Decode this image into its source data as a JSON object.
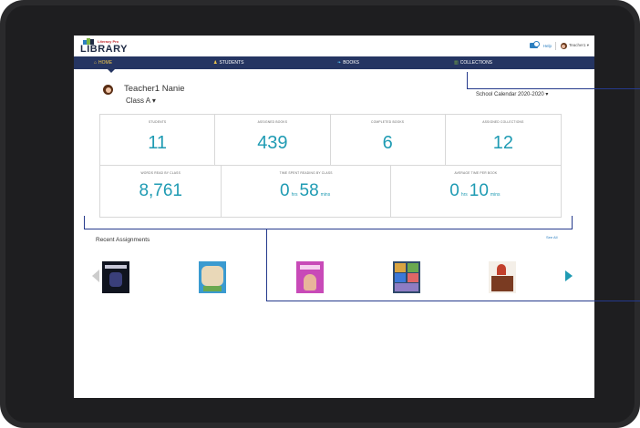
{
  "header": {
    "logo_small": "Literacy Pro",
    "logo_text": "LIBRARY",
    "help_label": "Help",
    "user_label": "Teacher1 ▾"
  },
  "nav": {
    "items": [
      {
        "label": "HOME",
        "icon": "home-icon"
      },
      {
        "label": "STUDENTS",
        "icon": "student-icon"
      },
      {
        "label": "BOOKS",
        "icon": "book-icon"
      },
      {
        "label": "COLLECTIONS",
        "icon": "collections-icon"
      }
    ]
  },
  "teacher": {
    "name": "Teacher1 Nanie",
    "class_label": "Class A ▾"
  },
  "calendar": {
    "label": "School Calendar 2020-2020 ▾"
  },
  "stats": {
    "students": {
      "label": "STUDENTS",
      "value": "11"
    },
    "assigned_books": {
      "label": "ASSIGNED BOOKS",
      "value": "439"
    },
    "completed_books": {
      "label": "COMPLETED BOOKS",
      "value": "6"
    },
    "assigned_collections": {
      "label": "ASSIGNED COLLECTIONS",
      "value": "12"
    },
    "words_read": {
      "label": "WORDS READ BY CLASS",
      "value": "8,761"
    },
    "time_spent": {
      "label": "TIME SPENT READING BY CLASS",
      "hours": "0",
      "hours_unit": "hrs",
      "minutes": "58",
      "minutes_unit": "mins"
    },
    "avg_time": {
      "label": "AVERAGE TIME PER BOOK",
      "hours": "0",
      "hours_unit": "hrs",
      "minutes": "10",
      "minutes_unit": "mins"
    }
  },
  "recent": {
    "title": "Recent Assignments",
    "see_all": "See All",
    "books": [
      {
        "name": "book-cover-1"
      },
      {
        "name": "book-cover-2"
      },
      {
        "name": "book-cover-3"
      },
      {
        "name": "book-cover-4"
      },
      {
        "name": "book-cover-5"
      }
    ]
  },
  "colors": {
    "nav_bg": "#253562",
    "accent": "#1f9bb3",
    "home_active": "#f2c94c",
    "callout": "#253a8c"
  }
}
